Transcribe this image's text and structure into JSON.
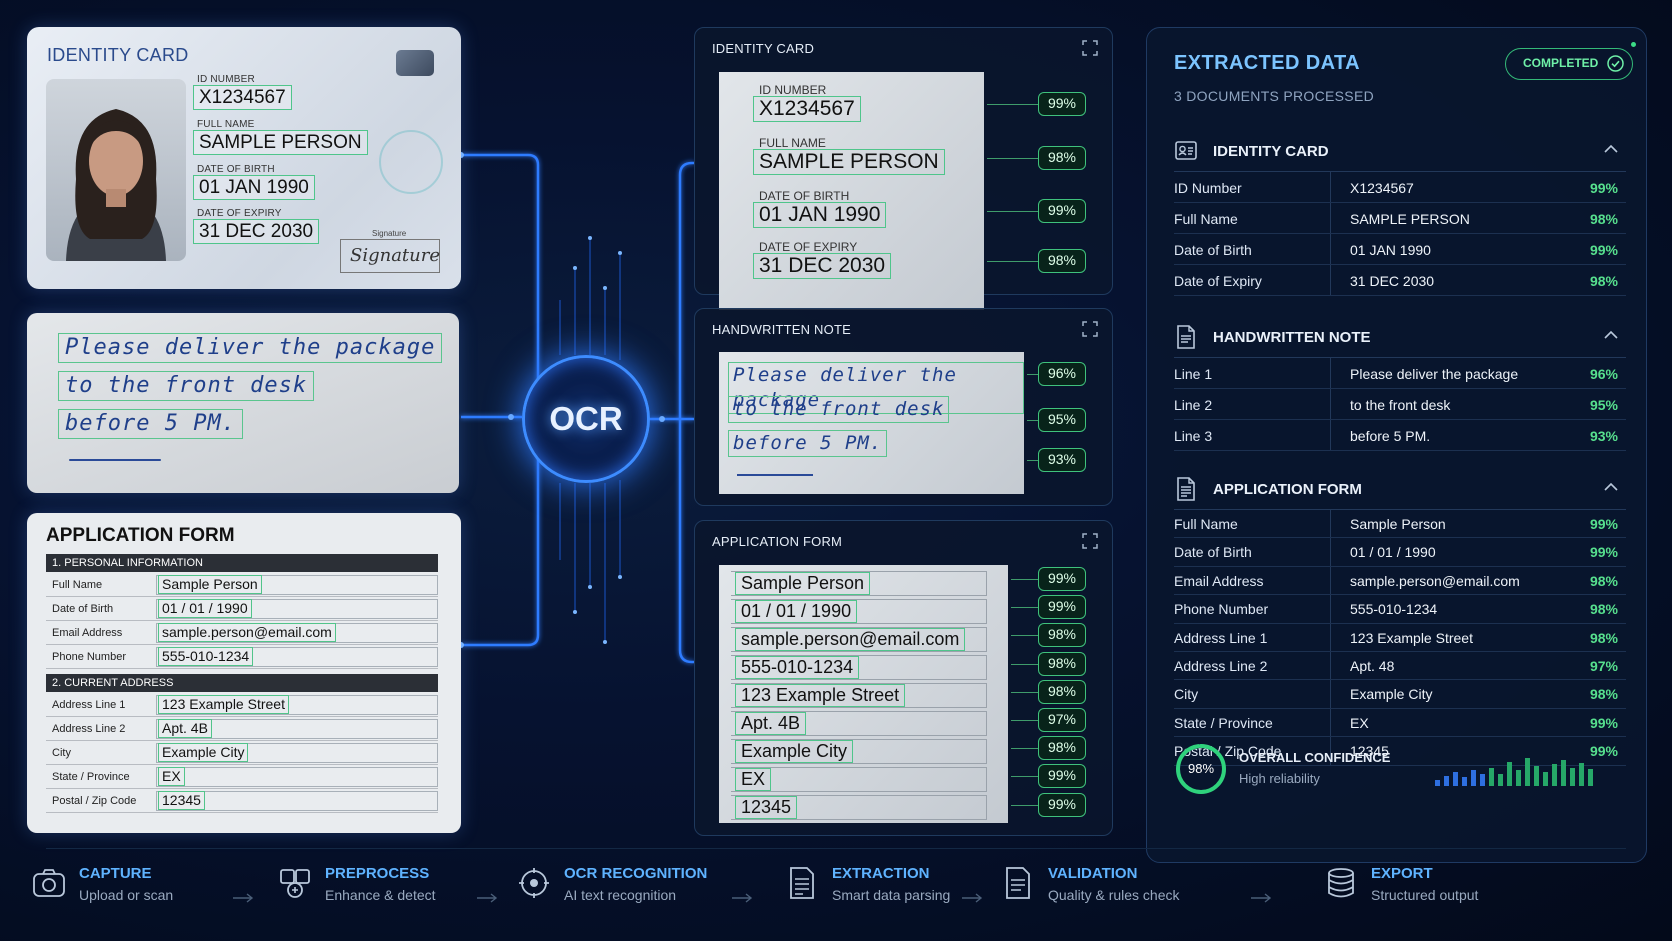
{
  "id_card": {
    "title": "IDENTITY CARD",
    "id_label": "ID NUMBER",
    "id_value": "X1234567",
    "name_label": "FULL NAME",
    "name_value": "SAMPLE PERSON",
    "dob_label": "DATE OF BIRTH",
    "dob_value": "01 JAN 1990",
    "exp_label": "DATE OF EXPIRY",
    "exp_value": "31 DEC 2030",
    "sig_label": "Signature",
    "sig_text": "Signature"
  },
  "note": {
    "lines": [
      "Please deliver the package",
      "to the front desk",
      "before 5 PM."
    ]
  },
  "form": {
    "title": "APPLICATION FORM",
    "sec1": "1. PERSONAL INFORMATION",
    "sec2": "2. CURRENT ADDRESS",
    "rows1": [
      {
        "label": "Full Name",
        "value": "Sample Person"
      },
      {
        "label": "Date of Birth",
        "value": "01 / 01 / 1990"
      },
      {
        "label": "Email Address",
        "value": "sample.person@email.com"
      },
      {
        "label": "Phone Number",
        "value": "555-010-1234"
      }
    ],
    "rows2": [
      {
        "label": "Address Line 1",
        "value": "123 Example Street"
      },
      {
        "label": "Address Line 2",
        "value": "Apt. 4B"
      },
      {
        "label": "City",
        "value": "Example City"
      },
      {
        "label": "State / Province",
        "value": "EX"
      },
      {
        "label": "Postal / Zip Code",
        "value": "12345"
      }
    ]
  },
  "ocr": {
    "label": "OCR"
  },
  "panels": {
    "id_card": {
      "title": "IDENTITY CARD",
      "labels": [
        "ID NUMBER",
        "FULL NAME",
        "DATE OF BIRTH",
        "DATE OF EXPIRY"
      ],
      "values": [
        "X1234567",
        "SAMPLE PERSON",
        "01 JAN 1990",
        "31 DEC 2030"
      ],
      "conf": [
        "99%",
        "98%",
        "99%",
        "98%"
      ]
    },
    "note": {
      "title": "HANDWRITTEN NOTE",
      "lines": [
        "Please deliver the package",
        "to the front desk",
        "before 5 PM."
      ],
      "conf": [
        "96%",
        "95%",
        "93%"
      ]
    },
    "form": {
      "title": "APPLICATION FORM",
      "values": [
        "Sample Person",
        "01 / 01 / 1990",
        "sample.person@email.com",
        "555-010-1234",
        "123 Example Street",
        "Apt. 4B",
        "Example City",
        "EX",
        "12345"
      ],
      "conf": [
        "99%",
        "99%",
        "98%",
        "98%",
        "98%",
        "97%",
        "98%",
        "99%",
        "99%"
      ]
    }
  },
  "extracted": {
    "title": "EXTRACTED DATA",
    "subtitle": "3 DOCUMENTS PROCESSED",
    "status": "COMPLETED",
    "sections": [
      {
        "title": "IDENTITY CARD",
        "rows": [
          {
            "k": "ID Number",
            "v": "X1234567",
            "p": "99%"
          },
          {
            "k": "Full Name",
            "v": "SAMPLE PERSON",
            "p": "98%"
          },
          {
            "k": "Date of Birth",
            "v": "01 JAN 1990",
            "p": "99%"
          },
          {
            "k": "Date of Expiry",
            "v": "31 DEC 2030",
            "p": "98%"
          }
        ]
      },
      {
        "title": "HANDWRITTEN NOTE",
        "rows": [
          {
            "k": "Line 1",
            "v": "Please deliver the package",
            "p": "96%"
          },
          {
            "k": "Line 2",
            "v": "to the front desk",
            "p": "95%"
          },
          {
            "k": "Line 3",
            "v": "before 5 PM.",
            "p": "93%"
          }
        ]
      },
      {
        "title": "APPLICATION FORM",
        "rows": [
          {
            "k": "Full Name",
            "v": "Sample Person",
            "p": "99%"
          },
          {
            "k": "Date of Birth",
            "v": "01 / 01 / 1990",
            "p": "99%"
          },
          {
            "k": "Email Address",
            "v": "sample.person@email.com",
            "p": "98%"
          },
          {
            "k": "Phone Number",
            "v": "555-010-1234",
            "p": "98%"
          },
          {
            "k": "Address Line 1",
            "v": "123 Example Street",
            "p": "98%"
          },
          {
            "k": "Address Line 2",
            "v": "Apt. 48",
            "p": "97%"
          },
          {
            "k": "City",
            "v": "Example City",
            "p": "98%"
          },
          {
            "k": "State / Province",
            "v": "EX",
            "p": "99%"
          },
          {
            "k": "Postal / Zip Code",
            "v": "12345",
            "p": "99%"
          }
        ]
      }
    ],
    "overall": {
      "value": "98%",
      "fraction": 0.98,
      "label": "OVERALL CONFIDENCE",
      "sub": "High reliability"
    },
    "colors": {
      "accent": "#5fb3ff",
      "success": "#57e08e"
    }
  },
  "pipeline": [
    {
      "title": "CAPTURE",
      "desc": "Upload or scan",
      "icon": "camera-icon"
    },
    {
      "title": "PREPROCESS",
      "desc": "Enhance & detect",
      "icon": "preprocess-icon"
    },
    {
      "title": "OCR RECOGNITION",
      "desc": "AI text recognition",
      "icon": "ocr-icon"
    },
    {
      "title": "EXTRACTION",
      "desc": "Smart data parsing",
      "icon": "extraction-icon"
    },
    {
      "title": "VALIDATION",
      "desc": "Quality & rules check",
      "icon": "validation-icon"
    },
    {
      "title": "EXPORT",
      "desc": "Structured output",
      "icon": "database-icon"
    }
  ]
}
